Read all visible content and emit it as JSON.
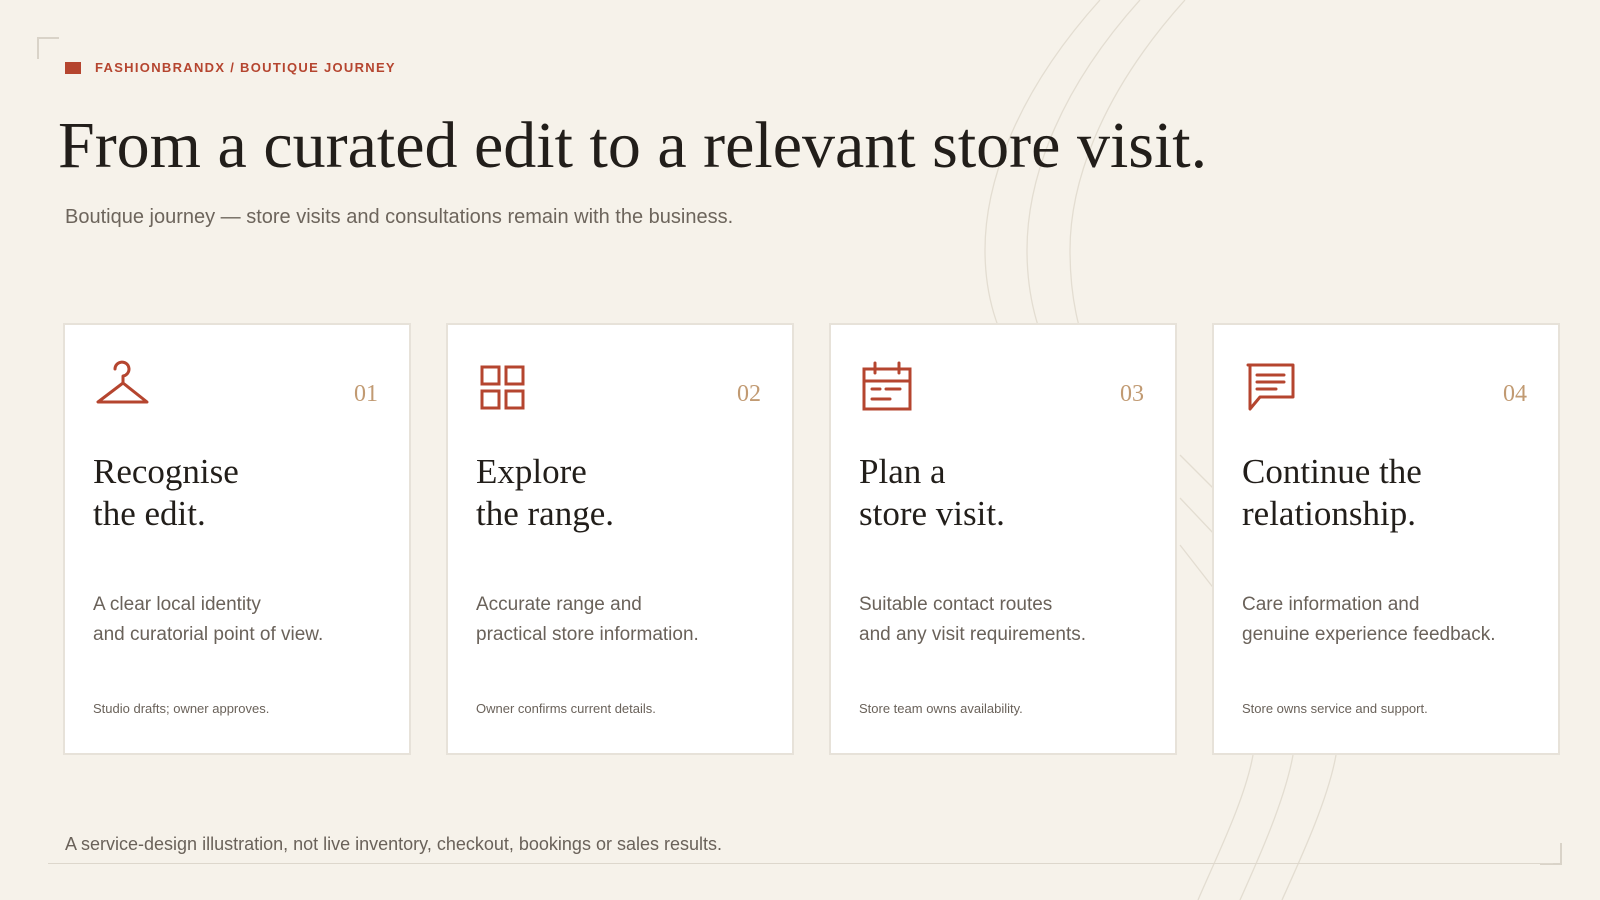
{
  "colors": {
    "accent": "#b5452f",
    "number": "#c19a72",
    "background": "#f6f2ea",
    "card": "#ffffff"
  },
  "header": {
    "eyebrow": "FASHIONBRANDX / BOUTIQUE JOURNEY",
    "title": "From a curated edit to a relevant store visit.",
    "subtitle": "Boutique journey — store visits and consultations remain with the business."
  },
  "steps": [
    {
      "icon": "hanger-icon",
      "number": "01",
      "title_lines": [
        "Recognise",
        "the edit."
      ],
      "desc_lines": [
        "A clear local identity",
        "and curatorial point of view."
      ],
      "note": "Studio drafts; owner approves."
    },
    {
      "icon": "grid-icon",
      "number": "02",
      "title_lines": [
        "Explore",
        "the range."
      ],
      "desc_lines": [
        "Accurate range and",
        "practical store information."
      ],
      "note": "Owner confirms current details."
    },
    {
      "icon": "calendar-icon",
      "number": "03",
      "title_lines": [
        "Plan a",
        "store visit."
      ],
      "desc_lines": [
        "Suitable contact routes",
        "and any visit requirements."
      ],
      "note": "Store team owns availability."
    },
    {
      "icon": "chat-bubble-icon",
      "number": "04",
      "title_lines": [
        "Continue the",
        "relationship."
      ],
      "desc_lines": [
        "Care information and",
        "genuine experience feedback."
      ],
      "note": "Store owns service and support."
    }
  ],
  "footer": {
    "note": "A service-design illustration, not live inventory, checkout, bookings or sales results."
  }
}
